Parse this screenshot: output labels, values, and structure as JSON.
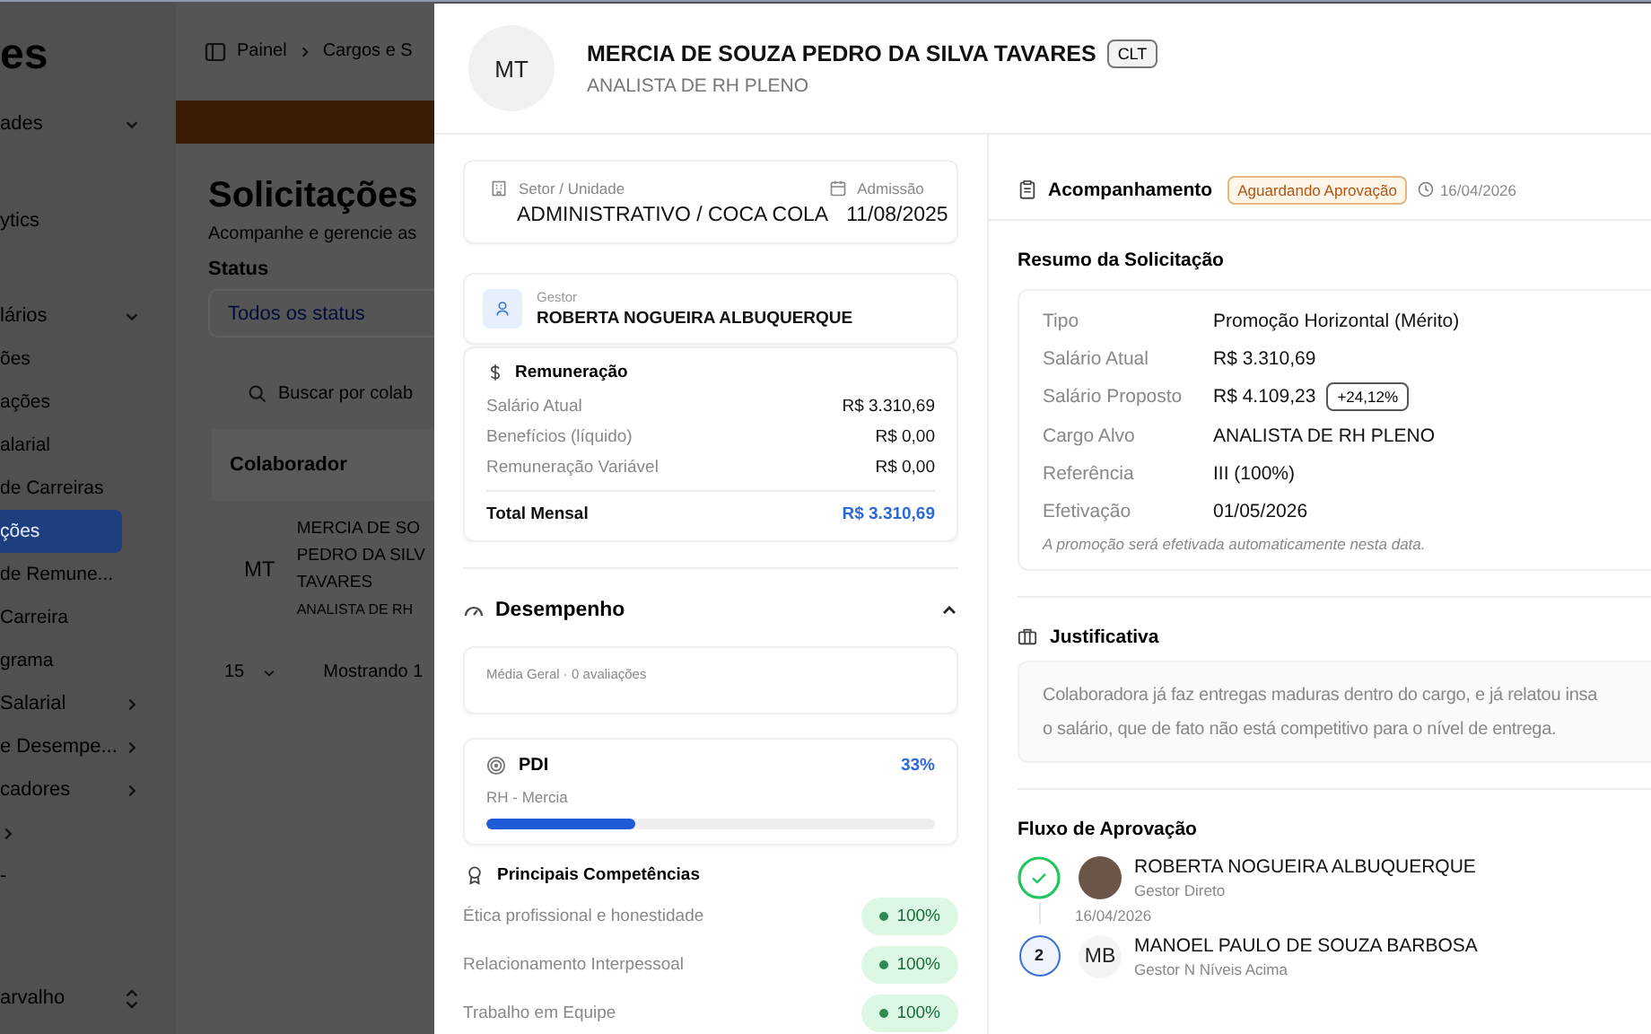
{
  "background": {
    "app_title": "es",
    "sidebar": {
      "sections": [
        {
          "items": [
            {
              "label": "ades",
              "kind": "group",
              "expanded": true
            }
          ]
        },
        {
          "items": [
            {
              "label": "ytics",
              "kind": "link",
              "selected": false
            }
          ]
        },
        {
          "items": [
            {
              "label": "lários",
              "kind": "group",
              "expanded": true,
              "children": [
                {
                  "label": "ões",
                  "selected": false
                },
                {
                  "label": "ações",
                  "selected": false
                },
                {
                  "label": "alarial",
                  "selected": false
                },
                {
                  "label": "de Carreiras",
                  "selected": false
                },
                {
                  "label": "ções",
                  "selected": true
                },
                {
                  "label": "de Remune...",
                  "selected": false
                },
                {
                  "label": "Carreira",
                  "selected": false
                },
                {
                  "label": "grama",
                  "selected": false
                }
              ]
            },
            {
              "label": "Salarial",
              "kind": "group",
              "expanded": false
            },
            {
              "label": "e Desempe...",
              "kind": "group",
              "expanded": false
            },
            {
              "label": "cadores",
              "kind": "group",
              "expanded": false
            },
            {
              "kind": "group",
              "expanded": false
            },
            {
              "label": "-",
              "kind": "link",
              "selected": false
            }
          ]
        }
      ],
      "user": {
        "name": "arvalho"
      }
    },
    "breadcrumb": [
      "Painel",
      "Cargos e S"
    ],
    "page_title": "Solicitações",
    "page_subtitle": "Acompanhe e gerencie as",
    "status_filter": {
      "label": "Status",
      "value": "Todos os status"
    },
    "search": {
      "placeholder": "Buscar por colab"
    },
    "table": {
      "columns": [
        "Colaborador"
      ],
      "rows": [
        {
          "initials": "MT",
          "name_lines": [
            "MERCIA DE SO",
            "PEDRO DA SILV",
            "TAVARES"
          ],
          "role": "ANALISTA DE RH"
        }
      ]
    },
    "pagination": {
      "page_size": "15",
      "summary": "Mostrando 1"
    }
  },
  "modal": {
    "header": {
      "initials": "MT",
      "name": "MERCIA DE SOUZA PEDRO DA SILVA TAVARES",
      "badge": "CLT",
      "role": "ANALISTA DE RH PLENO"
    },
    "info": {
      "sector_label": "Setor / Unidade",
      "sector": "ADMINISTRATIVO / COCA COLA",
      "admission_label": "Admissão",
      "admission": "11/08/2025"
    },
    "manager": {
      "label": "Gestor",
      "name": "ROBERTA NOGUEIRA ALBUQUERQUE"
    },
    "compensation": {
      "title": "Remuneração",
      "rows": [
        {
          "label": "Salário Atual",
          "value": "R$ 3.310,69"
        },
        {
          "label": "Benefícios (líquido)",
          "value": "R$ 0,00"
        },
        {
          "label": "Remuneração Variável",
          "value": "R$ 0,00"
        }
      ],
      "total": {
        "label": "Total Mensal",
        "value": "R$ 3.310,69"
      }
    },
    "performance": {
      "title": "Desempenho",
      "expanded": true,
      "average": "Média Geral · 0 avaliações",
      "pdi": {
        "title": "PDI",
        "percent": "33%",
        "name": "RH - Mercia",
        "level": 0.33
      },
      "competencies": {
        "title": "Principais Competências",
        "items": [
          {
            "name": "Ética profissional e honestidade",
            "score": "100%"
          },
          {
            "name": "Relacionamento Interpessoal",
            "score": "100%"
          },
          {
            "name": "Trabalho em Equipe",
            "score": "100%"
          }
        ]
      }
    },
    "tracking": {
      "title": "Acompanhamento",
      "status": "Aguardando Aprovação",
      "date": "16/04/2026"
    },
    "summary": {
      "title": "Resumo da Solicitação",
      "rows": [
        {
          "label": "Tipo",
          "value": "Promoção Horizontal (Mérito)"
        },
        {
          "label": "Salário Atual",
          "value": "R$ 3.310,69"
        },
        {
          "label": "Salário Proposto",
          "value": "R$ 4.109,23",
          "badge": "+24,12%"
        },
        {
          "label": "Cargo Alvo",
          "value": "ANALISTA DE RH PLENO"
        },
        {
          "label": "Referência",
          "value": "III (100%)"
        },
        {
          "label": "Efetivação",
          "value": "01/05/2026"
        }
      ],
      "note": "A promoção será efetivada automaticamente nesta data."
    },
    "justification": {
      "title": "Justificativa",
      "lines": [
        "Colaboradora já faz entregas maduras dentro do cargo, e já relatou insa",
        "o salário, que de fato não está competitivo para o nível de entrega."
      ]
    },
    "approval_flow": {
      "title": "Fluxo de Aprovação",
      "steps": [
        {
          "kind": "done",
          "avatar": {
            "kind": "photo"
          },
          "name": "ROBERTA NOGUEIRA ALBUQUERQUE",
          "role": "Gestor Direto",
          "date": "16/04/2026"
        },
        {
          "kind": "current",
          "number": "2",
          "avatar": {
            "kind": "initials",
            "initials": "MB"
          },
          "name": "MANOEL PAULO DE SOUZA BARBOSA",
          "role": "Gestor N Níveis Acima"
        }
      ]
    }
  }
}
